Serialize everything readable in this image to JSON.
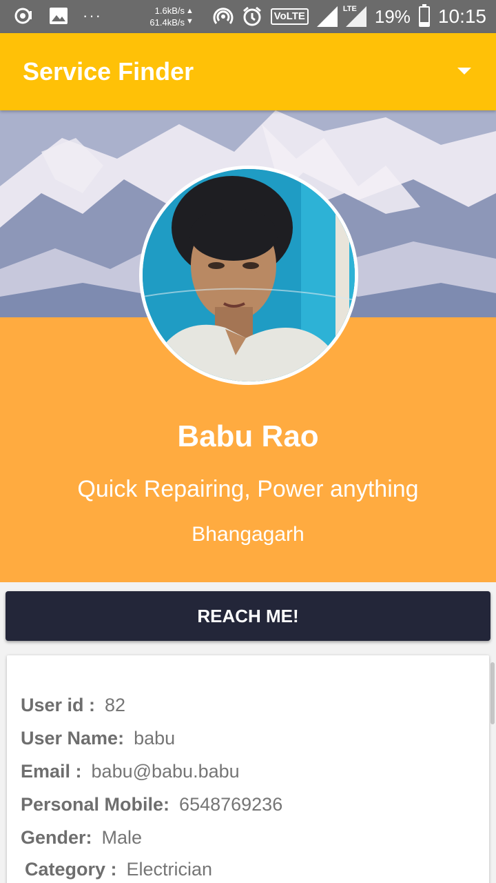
{
  "status_bar": {
    "net_up": "1.6kB/s",
    "net_down": "61.4kB/s",
    "volte": "VoLTE",
    "lte": "LTE",
    "battery": "19%",
    "battery_level": 0.19,
    "time": "10:15",
    "dots": "···"
  },
  "toolbar": {
    "title": "Service Finder"
  },
  "profile": {
    "name": "Babu Rao",
    "tagline": "Quick Repairing, Power anything",
    "location": "Bhangagarh"
  },
  "action": {
    "reach_label": "REACH ME!"
  },
  "details": [
    {
      "label": "User id :",
      "value": "82"
    },
    {
      "label": "User Name:",
      "value": "babu"
    },
    {
      "label": "Email :",
      "value": "babu@babu.babu"
    },
    {
      "label": "Personal Mobile:",
      "value": "6548769236"
    },
    {
      "label": "Gender:",
      "value": "Male"
    },
    {
      "label": "Category :",
      "value": "Electrician"
    }
  ],
  "colors": {
    "toolbar": "#ffc107",
    "panel": "#ffab40",
    "button": "#232639"
  }
}
